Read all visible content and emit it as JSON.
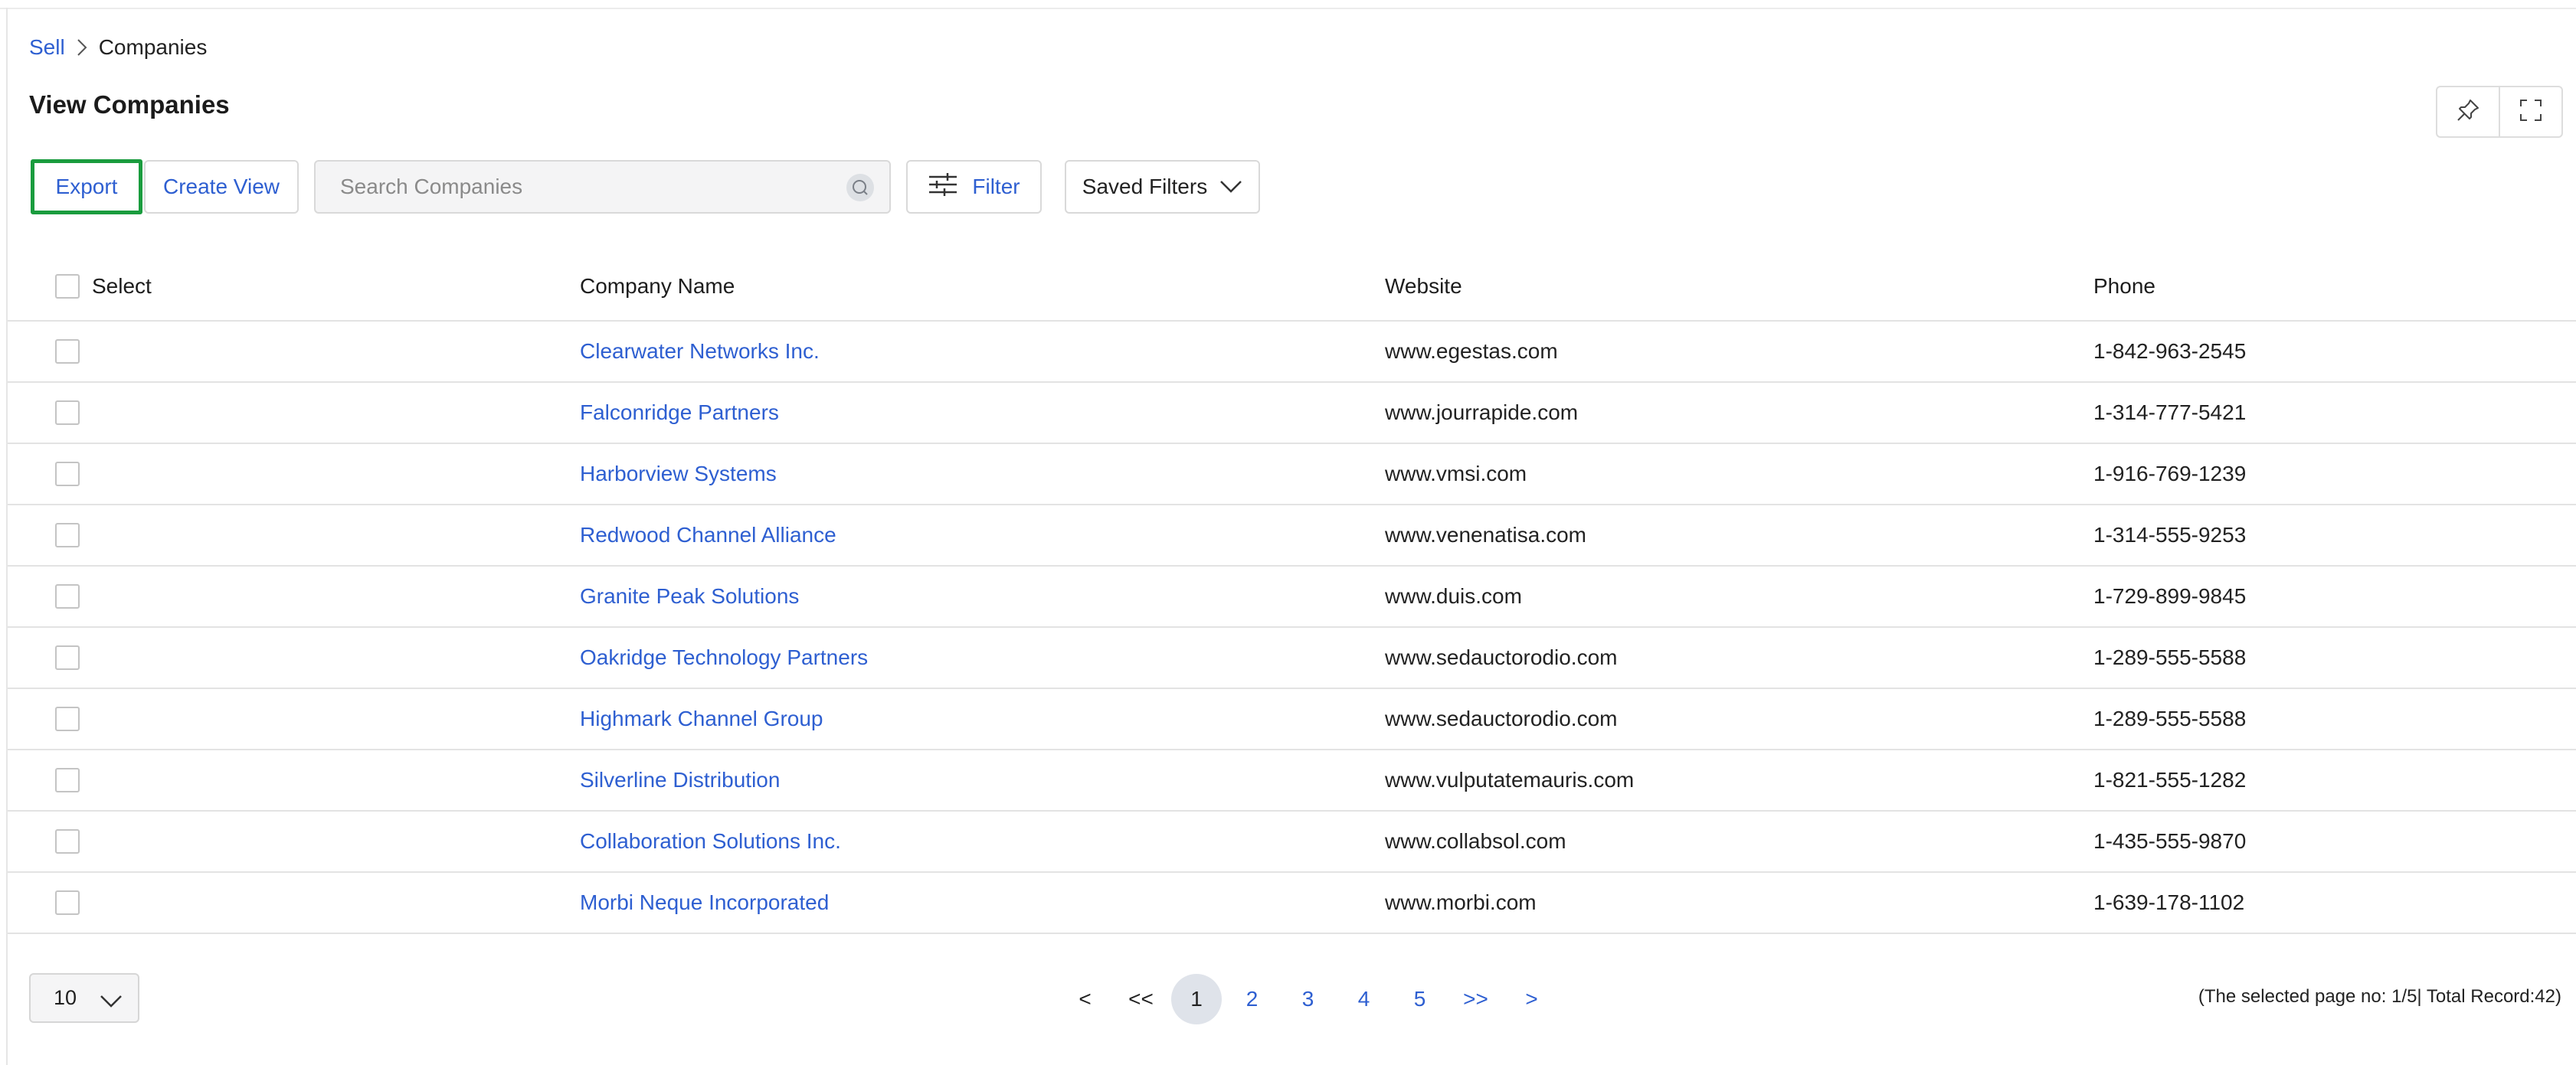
{
  "breadcrumb": {
    "parent": "Sell",
    "current": "Companies"
  },
  "page": {
    "title": "View Companies"
  },
  "toolbar": {
    "export_label": "Export",
    "create_view_label": "Create View",
    "search_placeholder": "Search Companies",
    "filter_label": "Filter",
    "saved_filters_label": "Saved Filters"
  },
  "icons": {
    "pin": "pin-icon",
    "fullscreen": "fullscreen-icon",
    "search": "search-icon",
    "filter": "sliders-icon",
    "dropdown": "chevron-down-icon",
    "separator": "chevron-right-icon"
  },
  "colors": {
    "link": "#2e5fd1",
    "export_highlight": "#1a9c3e",
    "active_page": "#dfe3ea"
  },
  "table": {
    "columns": {
      "select": "Select",
      "name": "Company Name",
      "website": "Website",
      "phone": "Phone"
    },
    "rows": [
      {
        "name": "Clearwater Networks Inc.",
        "website": "www.egestas.com",
        "phone": "1-842-963-2545"
      },
      {
        "name": "Falconridge Partners",
        "website": "www.jourrapide.com",
        "phone": "1-314-777-5421"
      },
      {
        "name": "Harborview Systems",
        "website": "www.vmsi.com",
        "phone": "1-916-769-1239"
      },
      {
        "name": "Redwood Channel Alliance",
        "website": "www.venenatisa.com",
        "phone": "1-314-555-9253"
      },
      {
        "name": "Granite Peak Solutions",
        "website": "www.duis.com",
        "phone": "1-729-899-9845"
      },
      {
        "name": "Oakridge Technology Partners",
        "website": "www.sedauctorodio.com",
        "phone": "1-289-555-5588"
      },
      {
        "name": "Highmark Channel Group",
        "website": "www.sedauctorodio.com",
        "phone": "1-289-555-5588"
      },
      {
        "name": "Silverline Distribution",
        "website": "www.vulputatemauris.com",
        "phone": "1-821-555-1282"
      },
      {
        "name": "Collaboration Solutions Inc.",
        "website": "www.collabsol.com",
        "phone": "1-435-555-9870"
      },
      {
        "name": "Morbi Neque Incorporated",
        "website": "www.morbi.com",
        "phone": "1-639-178-1102"
      }
    ]
  },
  "pagination": {
    "page_size": "10",
    "prev": "<",
    "first": "<<",
    "pages": [
      "1",
      "2",
      "3",
      "4",
      "5"
    ],
    "active_page": "1",
    "last": ">>",
    "next": ">",
    "status": "(The selected page no: 1/5| Total Record:42)"
  }
}
